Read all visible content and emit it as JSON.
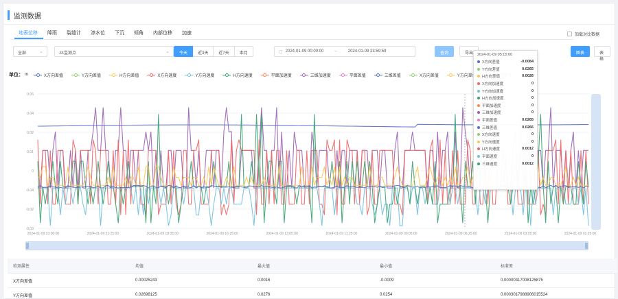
{
  "page_title": "监测数据",
  "tabs": [
    "地表位移",
    "降雨",
    "裂缝计",
    "渗水位",
    "下沉",
    "倾角",
    "内部位移",
    "加速"
  ],
  "compare_label": "加载对比数据",
  "toolbar": {
    "type_select": "全部",
    "device_select": "JX监测点",
    "range_buttons": [
      "今天",
      "近3天",
      "近7天",
      "本月"
    ],
    "date_start": "2024-01-09 00:00:00",
    "date_end": "2024-01-09 23:59:59",
    "query_label": "查询",
    "export_label": "导出",
    "chart_label": "图表",
    "table_label": "表格"
  },
  "legend": {
    "unit_label": "单位：",
    "unit_value": "m",
    "items": [
      {
        "name": "X方向差值",
        "color": "#5470c6"
      },
      {
        "name": "Y方向差值",
        "color": "#91cc75"
      },
      {
        "name": "H方向差值",
        "color": "#fac858"
      },
      {
        "name": "X方向速度",
        "color": "#ee6666"
      },
      {
        "name": "Y方向速度",
        "color": "#73c0de"
      },
      {
        "name": "H方向速度",
        "color": "#3ba272"
      },
      {
        "name": "平面加速度",
        "color": "#fc8452"
      },
      {
        "name": "三维加速度",
        "color": "#9a60b4"
      },
      {
        "name": "平面差值",
        "color": "#ea7ccc"
      },
      {
        "name": "三维差值",
        "color": "#5470c6"
      },
      {
        "name": "X方向差值",
        "color": "#91cc75"
      },
      {
        "name": "Y方向差值",
        "color": "#fac858"
      },
      {
        "name": "三维差值",
        "color": "#3ba272"
      }
    ]
  },
  "chart_data": {
    "type": "line",
    "ylabel": "",
    "y_ticks": [
      "0.06",
      "0.04",
      "0.02",
      "0.01",
      "0",
      "-0.04",
      "-0.02",
      "-0.03"
    ],
    "x_ticks": [
      "2024-01-09 23:00:00",
      "2024-01-09 21:25:00",
      "2024-01-09 18:05:00",
      "2024-01-09 16:25:00",
      "2024-01-09 13:05:00",
      "2024-01-09 11:25:00",
      "2024-01-09 09:05:00",
      "2024-01-09 06:25:00",
      "2024-01-09 03:05:00",
      "2024-01-09 01:25:00"
    ],
    "ylim": [
      -0.03,
      0.07
    ],
    "grid": true,
    "series": [
      {
        "name": "三维加速度",
        "color": "#9a60b4",
        "pattern": "pulse_high"
      },
      {
        "name": "三维差值",
        "color": "#5470c6",
        "pattern": "flat_high"
      },
      {
        "name": "X方向速度",
        "color": "#ee6666",
        "pattern": "pulse_mid"
      },
      {
        "name": "Y方向速度",
        "color": "#73c0de",
        "pattern": "spike_low"
      },
      {
        "name": "H方向速度",
        "color": "#3ba272",
        "pattern": "spike_mixed"
      },
      {
        "name": "H方向差值",
        "color": "#fac858",
        "pattern": "pulse_small"
      },
      {
        "name": "X方向差值",
        "color": "#5470c6",
        "pattern": "flat_zero"
      }
    ]
  },
  "tooltip": {
    "title": "2024-01-09 05:15:00",
    "rows": [
      {
        "name": "X方向差值",
        "value": "-0.0084",
        "color": "#5470c6"
      },
      {
        "name": "Y方向差值",
        "value": "0.0265",
        "color": "#91cc75"
      },
      {
        "name": "H方向差值",
        "value": "0.0026",
        "color": "#fac858"
      },
      {
        "name": "X方向加速度",
        "value": "0",
        "color": "#ee6666"
      },
      {
        "name": "Y方向加速度",
        "value": "0",
        "color": "#73c0de"
      },
      {
        "name": "H方向加速度",
        "value": "0",
        "color": "#3ba272"
      },
      {
        "name": "平面加速度",
        "value": "0",
        "color": "#fc8452"
      },
      {
        "name": "三维加速度",
        "value": "0",
        "color": "#9a60b4"
      },
      {
        "name": "平面差值",
        "value": "0.0265",
        "color": "#ea7ccc"
      },
      {
        "name": "三维差值",
        "value": "0.0266",
        "color": "#5470c6"
      },
      {
        "name": "X方向速度",
        "value": "0",
        "color": "#91cc75"
      },
      {
        "name": "Y方向速度",
        "value": "0",
        "color": "#fac858"
      },
      {
        "name": "H方向速度",
        "value": "0.0012",
        "color": "#ee6666"
      },
      {
        "name": "平面速度",
        "value": "0",
        "color": "#73c0de"
      },
      {
        "name": "三维速度",
        "value": "0.0012",
        "color": "#3ba272"
      }
    ]
  },
  "table": {
    "headers": [
      "检测属性",
      "均值",
      "最大值",
      "最小值",
      "标准差"
    ],
    "rows": [
      [
        "X方向差值",
        "0.00025243",
        "0.0016",
        "-0.0009",
        "0.00000417008125875"
      ],
      [
        "Y方向差值",
        "0.02698125",
        "0.0276",
        "0.0254",
        "0.0003017988906015524"
      ]
    ]
  }
}
